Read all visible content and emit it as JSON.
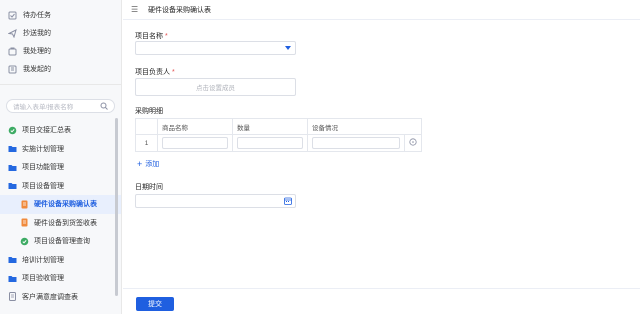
{
  "sidebar": {
    "top_items": [
      {
        "label": "待办任务",
        "icon": "todo-icon"
      },
      {
        "label": "抄送我的",
        "icon": "send-icon"
      },
      {
        "label": "我处理的",
        "icon": "handled-icon"
      },
      {
        "label": "我发起的",
        "icon": "initiated-icon"
      }
    ],
    "search": {
      "placeholder": "请输入表单/报表名称"
    },
    "tree": [
      {
        "label": "项目交接汇总表",
        "icon": "report-icon"
      },
      {
        "label": "实施计划管理",
        "icon": "folder-icon"
      },
      {
        "label": "项目功能管理",
        "icon": "folder-icon"
      },
      {
        "label": "项目设备管理",
        "icon": "folder-icon"
      },
      {
        "label": "硬件设备采购确认表",
        "icon": "form-icon",
        "child": true,
        "active": true
      },
      {
        "label": "硬件设备到货签收表",
        "icon": "form-icon",
        "child": true
      },
      {
        "label": "项目设备管理查询",
        "icon": "report-icon",
        "child": true
      },
      {
        "label": "培训计划管理",
        "icon": "folder-icon"
      },
      {
        "label": "项目验收管理",
        "icon": "folder-icon"
      },
      {
        "label": "客户满意度调查表",
        "icon": "form-icon"
      }
    ]
  },
  "header": {
    "title": "硬件设备采购确认表"
  },
  "form": {
    "project_name_label": "项目名称",
    "owner_label": "项目负责人",
    "owner_placeholder": "点击设置成员",
    "purchase_detail_label": "采购明细",
    "table": {
      "columns": [
        "",
        "商品名称",
        "数量",
        "设备情况"
      ],
      "rows": [
        {
          "index": "1"
        }
      ]
    },
    "add_label": "添加",
    "date_label": "日期时间",
    "required_mark": "*"
  },
  "footer": {
    "submit_label": "提交"
  },
  "colors": {
    "accent": "#1f5fe0",
    "required": "#e34d4d"
  }
}
